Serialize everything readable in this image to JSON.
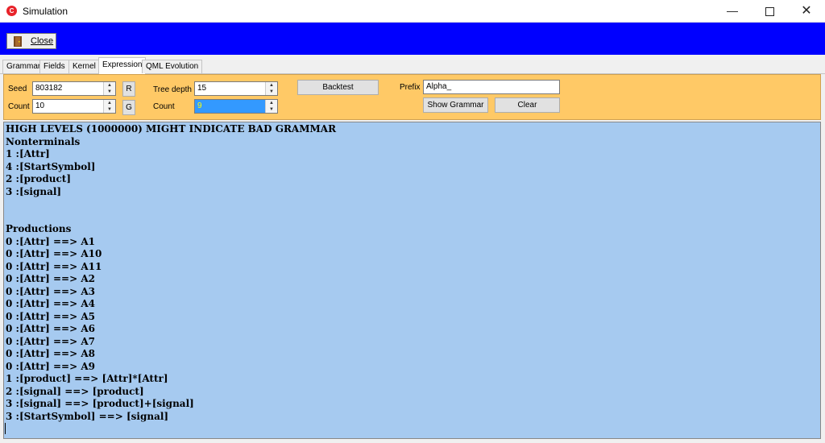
{
  "window": {
    "title": "Simulation",
    "icon": "app-logo-icon"
  },
  "toolbar": {
    "close_label": "Close",
    "close_icon": "door-exit-icon"
  },
  "tabs": [
    {
      "label": "Grammar",
      "active": false
    },
    {
      "label": "Fields",
      "active": false
    },
    {
      "label": "Kernel",
      "active": false
    },
    {
      "label": "Expression",
      "active": true
    },
    {
      "label": "QML Evolution",
      "active": false
    }
  ],
  "panel": {
    "seed_label": "Seed",
    "seed_value": "803182",
    "r_button": "R",
    "count_label": "Count",
    "count_value": "10",
    "g_button": "G",
    "tree_depth_label": "Tree depth",
    "tree_depth_value": "15",
    "count2_label": "Count",
    "count2_value": "9",
    "backtest_label": "Backtest",
    "prefix_label": "Prefix",
    "prefix_value": "Alpha_",
    "show_grammar_label": "Show Grammar",
    "clear_label": "Clear"
  },
  "output": {
    "text": "HIGH LEVELS (1000000) MIGHT INDICATE BAD GRAMMAR\nNonterminals\n1 :[Attr]\n4 :[StartSymbol]\n2 :[product]\n3 :[signal]\n\n\nProductions\n0 :[Attr] ==> A1\n0 :[Attr] ==> A10\n0 :[Attr] ==> A11\n0 :[Attr] ==> A2\n0 :[Attr] ==> A3\n0 :[Attr] ==> A4\n0 :[Attr] ==> A5\n0 :[Attr] ==> A6\n0 :[Attr] ==> A7\n0 :[Attr] ==> A8\n0 :[Attr] ==> A9\n1 :[product] ==> [Attr]*[Attr]\n2 :[signal] ==> [product]\n3 :[signal] ==> [product]+[signal]\n3 :[StartSymbol] ==> [signal]"
  },
  "colors": {
    "toolbar_bg": "#0000ff",
    "panel_bg": "#ffc966",
    "output_bg": "#a6caf0",
    "selected_field": "#3399ff"
  }
}
